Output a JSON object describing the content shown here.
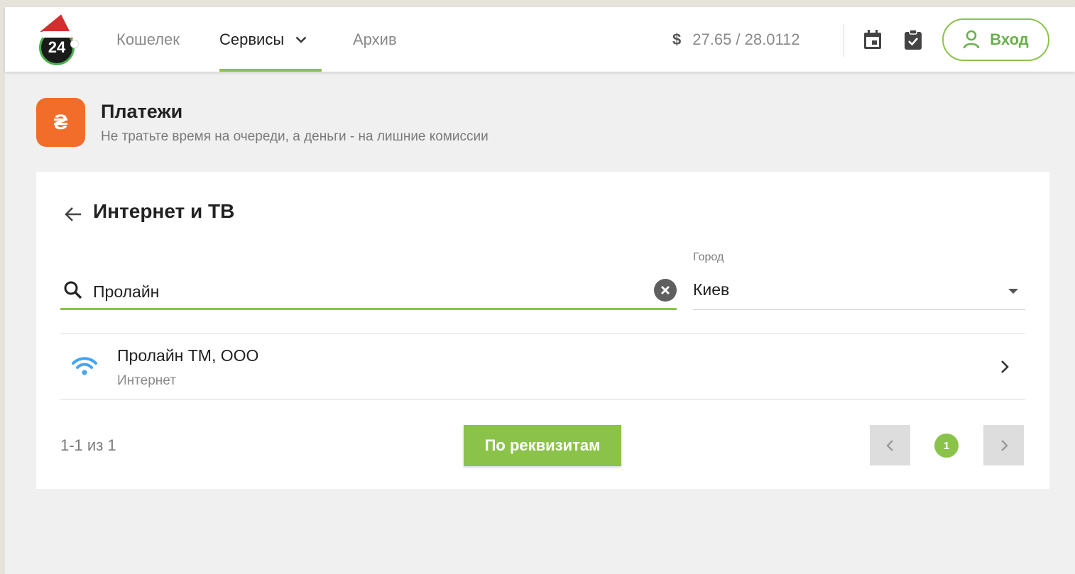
{
  "header": {
    "logo_text": "24",
    "nav": [
      {
        "label": "Кошелек"
      },
      {
        "label": "Сервисы"
      },
      {
        "label": "Архив"
      }
    ],
    "rate_symbol": "$",
    "rate": "27.65 / 28.0112",
    "login_label": "Вход"
  },
  "section": {
    "icon_symbol": "₴",
    "title": "Платежи",
    "subtitle": "Не тратьте время на очереди, а деньги - на лишние комиссии"
  },
  "card": {
    "title": "Интернет и ТВ",
    "search_value": "Пролайн",
    "city_label": "Город",
    "city_value": "Киев",
    "results": [
      {
        "title": "Пролайн ТМ, ООО",
        "category": "Интернет",
        "icon": "wifi-icon"
      }
    ],
    "count_text": "1-1 из 1",
    "requisites_button": "По реквизитам",
    "current_page": "1"
  },
  "colors": {
    "accent": "#8bc34a",
    "section_icon": "#f26c2a",
    "wifi": "#42a5f5"
  }
}
